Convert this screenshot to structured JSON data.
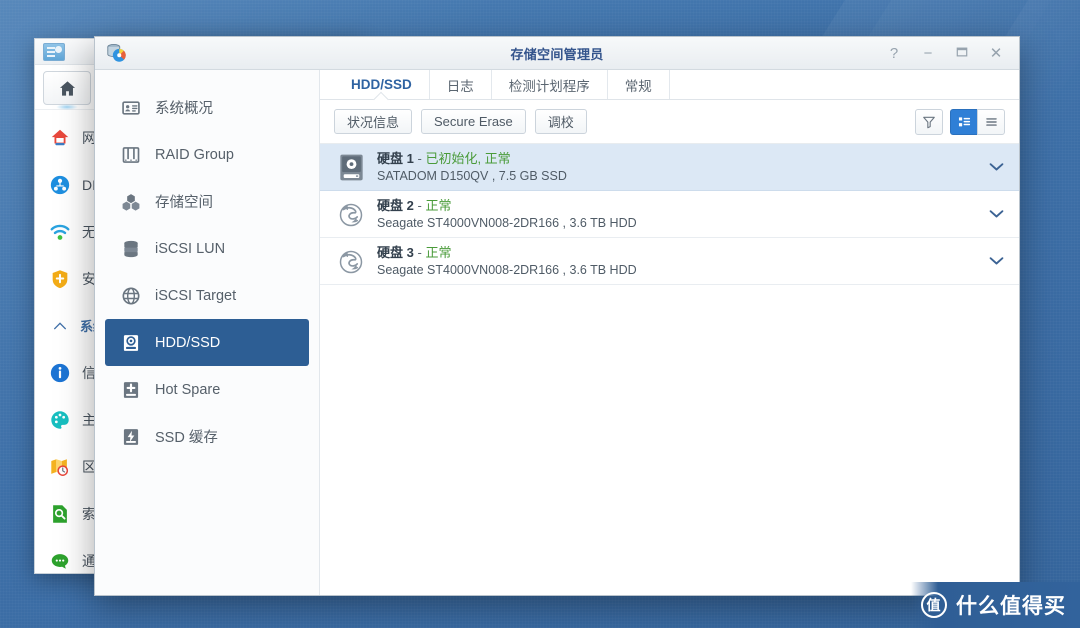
{
  "desktop": {
    "background_color": "#3f72aa"
  },
  "bg_window": {
    "app_icon": "dsm-package-icon",
    "home_button": "home-icon",
    "menu_items": [
      {
        "label": "网",
        "icon": "network-house-icon",
        "type": "item"
      },
      {
        "label": "DI",
        "icon": "ddns-icon",
        "type": "item"
      },
      {
        "label": "无",
        "icon": "wireless-icon",
        "type": "item"
      },
      {
        "label": "安",
        "icon": "security-shield-icon",
        "type": "item"
      },
      {
        "label": "系统",
        "icon": "chevron-up-icon",
        "type": "group"
      },
      {
        "label": "信",
        "icon": "info-icon",
        "type": "item"
      },
      {
        "label": "主",
        "icon": "theme-palette-icon",
        "type": "item"
      },
      {
        "label": "区",
        "icon": "regional-options-icon",
        "type": "item"
      },
      {
        "label": "索",
        "icon": "indexing-icon",
        "type": "item"
      },
      {
        "label": "通",
        "icon": "notification-icon",
        "type": "item"
      }
    ]
  },
  "window": {
    "title": "存储空间管理员",
    "app_icon": "storage-manager-icon",
    "controls": [
      {
        "name": "help-button",
        "glyph": "?"
      },
      {
        "name": "minimize-button",
        "glyph": "−"
      },
      {
        "name": "maximize-button",
        "glyph": "❐"
      },
      {
        "name": "close-button",
        "glyph": "✕"
      }
    ]
  },
  "sidebar": {
    "items": [
      {
        "label": "系统概况",
        "icon": "overview-icon",
        "active": false
      },
      {
        "label": "RAID Group",
        "icon": "raid-group-icon",
        "active": false
      },
      {
        "label": "存储空间",
        "icon": "storage-pool-icon",
        "active": false
      },
      {
        "label": "iSCSI LUN",
        "icon": "iscsi-lun-icon",
        "active": false
      },
      {
        "label": "iSCSI Target",
        "icon": "iscsi-target-icon",
        "active": false
      },
      {
        "label": "HDD/SSD",
        "icon": "hdd-ssd-icon",
        "active": true
      },
      {
        "label": "Hot Spare",
        "icon": "hot-spare-icon",
        "active": false
      },
      {
        "label": "SSD 缓存",
        "icon": "ssd-cache-icon",
        "active": false
      }
    ]
  },
  "tabs": [
    {
      "label": "HDD/SSD",
      "active": true
    },
    {
      "label": "日志",
      "active": false
    },
    {
      "label": "检测计划程序",
      "active": false
    },
    {
      "label": "常规",
      "active": false
    }
  ],
  "toolbar": {
    "buttons": [
      {
        "label": "状况信息",
        "name": "health-info-button"
      },
      {
        "label": "Secure Erase",
        "name": "secure-erase-button"
      },
      {
        "label": "调校",
        "name": "tuning-button"
      }
    ],
    "right_icons": [
      {
        "name": "filter-icon",
        "active": false
      },
      {
        "name": "detail-view-icon",
        "active": true
      },
      {
        "name": "list-view-icon",
        "active": false
      }
    ],
    "accent_color": "#2f7fd6"
  },
  "disks": [
    {
      "name": "硬盘 1",
      "separator": "-",
      "status": "已初始化, 正常",
      "model": "SATADOM D150QV , 7.5 GB SSD",
      "icon": "ssd-drive-icon",
      "selected": true,
      "expand": "chevron-down-icon"
    },
    {
      "name": "硬盘 2",
      "separator": "-",
      "status": "正常",
      "model": "Seagate ST4000VN008-2DR166 , 3.6 TB HDD",
      "icon": "seagate-logo-icon",
      "selected": false,
      "expand": "chevron-down-icon"
    },
    {
      "name": "硬盘 3",
      "separator": "-",
      "status": "正常",
      "model": "Seagate ST4000VN008-2DR166 , 3.6 TB HDD",
      "icon": "seagate-logo-icon",
      "selected": false,
      "expand": "chevron-down-icon"
    }
  ],
  "status_color": "#4a9b3a",
  "watermark": {
    "badge": "值",
    "text": "什么值得买"
  }
}
